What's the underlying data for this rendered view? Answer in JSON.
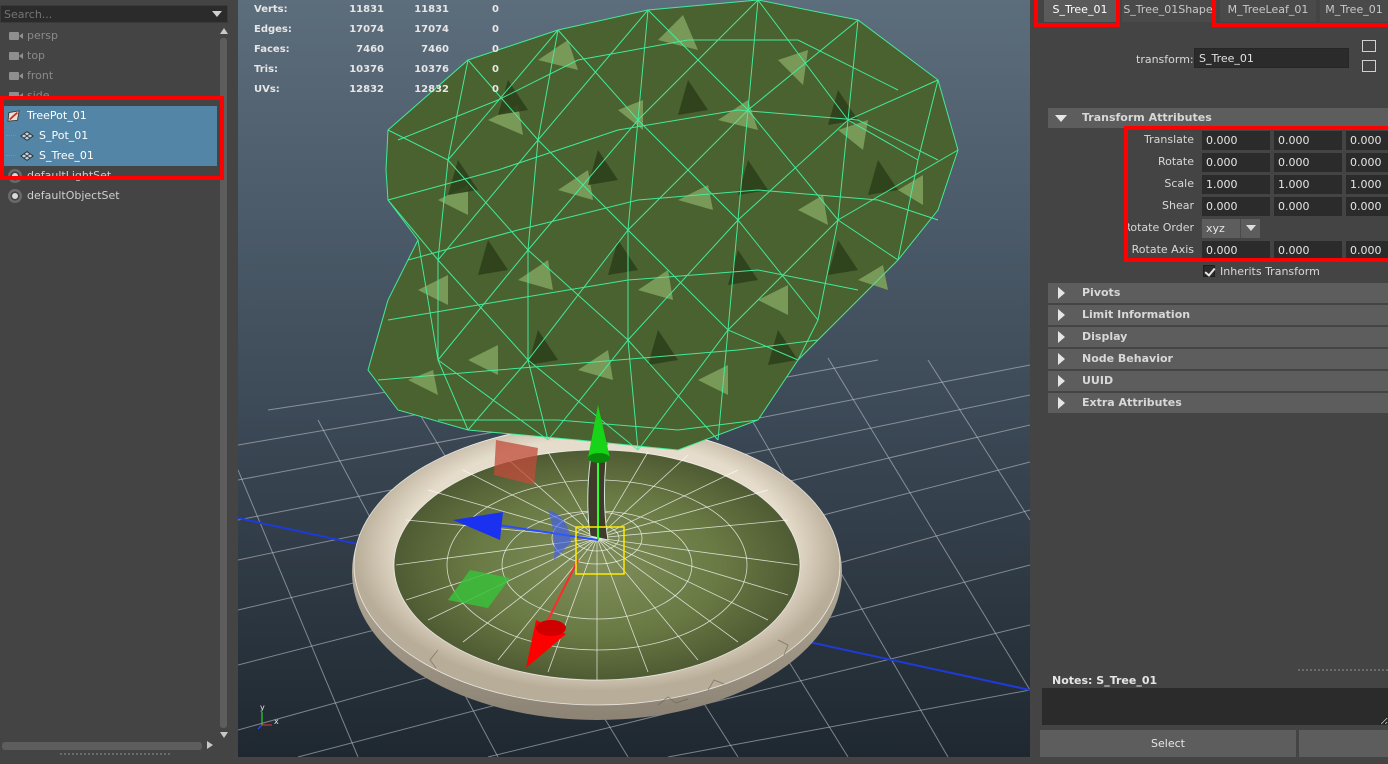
{
  "outliner": {
    "search_placeholder": "Search...",
    "items": [
      {
        "label": "persp",
        "type": "camera"
      },
      {
        "label": "top",
        "type": "camera"
      },
      {
        "label": "front",
        "type": "camera"
      },
      {
        "label": "side",
        "type": "camera"
      },
      {
        "label": "TreePot_01",
        "type": "group",
        "selected": true
      },
      {
        "label": "S_Pot_01",
        "type": "mesh",
        "selected": true
      },
      {
        "label": "S_Tree_01",
        "type": "mesh",
        "selected": true
      },
      {
        "label": "defaultLightSet",
        "type": "set"
      },
      {
        "label": "defaultObjectSet",
        "type": "set"
      }
    ],
    "selection_color": "#5285a6"
  },
  "hud": {
    "rows": [
      {
        "label": "Verts:",
        "a": "11831",
        "b": "11831",
        "c": "0"
      },
      {
        "label": "Edges:",
        "a": "17074",
        "b": "17074",
        "c": "0"
      },
      {
        "label": "Faces:",
        "a": "7460",
        "b": "7460",
        "c": "0"
      },
      {
        "label": "Tris:",
        "a": "10376",
        "b": "10376",
        "c": "0"
      },
      {
        "label": "UVs:",
        "a": "12832",
        "b": "12832",
        "c": "0"
      }
    ]
  },
  "axis_gizmo": {
    "y": "y",
    "x": "x"
  },
  "attribute_editor": {
    "tabs": [
      "S_Tree_01",
      "S_Tree_01Shape",
      "M_TreeLeaf_01",
      "M_Tree_01"
    ],
    "active_tab": "S_Tree_01",
    "node_type_label": "transform:",
    "node_name": "S_Tree_01",
    "transform_section": "Transform Attributes",
    "properties": [
      {
        "label": "Translate",
        "values": [
          "0.000",
          "0.000",
          "0.000"
        ]
      },
      {
        "label": "Rotate",
        "values": [
          "0.000",
          "0.000",
          "0.000"
        ]
      },
      {
        "label": "Scale",
        "values": [
          "1.000",
          "1.000",
          "1.000"
        ]
      },
      {
        "label": "Shear",
        "values": [
          "0.000",
          "0.000",
          "0.000"
        ]
      },
      {
        "label": "Rotate Axis",
        "values": [
          "0.000",
          "0.000",
          "0.000"
        ]
      }
    ],
    "rotate_order": {
      "label": "Rotate Order",
      "value": "xyz"
    },
    "inherits_transform": {
      "label": "Inherits Transform",
      "checked": true
    },
    "collapsed_sections": [
      "Pivots",
      "Limit Information",
      "Display",
      "Node Behavior",
      "UUID",
      "Extra Attributes"
    ],
    "notes_label": "Notes:",
    "notes_node": "S_Tree_01",
    "select_button": "Select"
  },
  "annotation_color": "#ff0000"
}
